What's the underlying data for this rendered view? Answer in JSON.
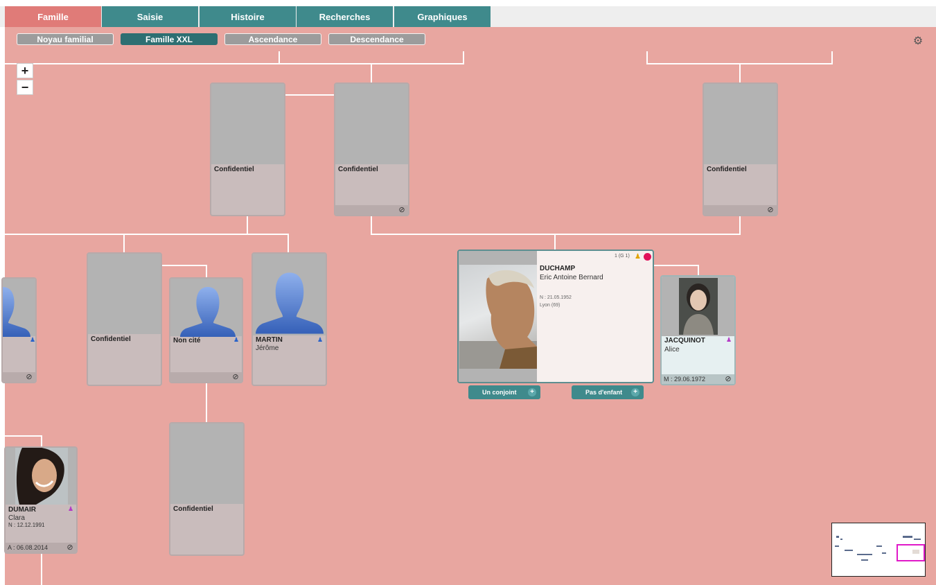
{
  "tabs": [
    {
      "label": "Famille",
      "active": true
    },
    {
      "label": "Saisie",
      "active": false
    },
    {
      "label": "Histoire",
      "active": false
    },
    {
      "label": "Recherches",
      "active": false
    },
    {
      "label": "Graphiques",
      "active": false
    }
  ],
  "subtabs": [
    {
      "label": "Noyau familial",
      "active": false
    },
    {
      "label": "Famille XXL",
      "active": true
    },
    {
      "label": "Ascendance",
      "active": false
    },
    {
      "label": "Descendance",
      "active": false
    }
  ],
  "zoom": {
    "plus": "+",
    "minus": "−"
  },
  "cards": {
    "conf1": {
      "name": "Confidentiel"
    },
    "conf2": {
      "name": "Confidentiel"
    },
    "conf3": {
      "name": "Confidentiel"
    },
    "conf4": {
      "name": "Confidentiel"
    },
    "conf5": {
      "name": "Confidentiel"
    },
    "noncite": {
      "name": "Non cité"
    },
    "martin": {
      "name": "MARTIN",
      "given": "Jérôme"
    },
    "jacquinot": {
      "name": "JACQUINOT",
      "given": "Alice",
      "footer": "M : 29.06.1972"
    },
    "dumair": {
      "name": "DUMAIR",
      "given": "Clara",
      "birth": "N : 12.12.1991",
      "footer": "A : 06.08.2014"
    }
  },
  "main_person": {
    "badge": "1 (G 1)",
    "name": "DUCHAMP",
    "given": "Eric Antoine Bernard",
    "birth": "N : 21.05.1952",
    "place": "Lyon (69)"
  },
  "actions": {
    "spouse": "Un conjoint",
    "children": "Pas d'enfant",
    "plus": "+"
  },
  "icons": {
    "gear": "gear-icon",
    "link": "link-icon",
    "male": "male-person-icon",
    "female": "female-person-icon"
  },
  "colors": {
    "active_tab": "#e07b78",
    "inactive_tab": "#3f8a8c",
    "canvas": "#e8a6a0",
    "minimap_view": "#e019c8"
  }
}
